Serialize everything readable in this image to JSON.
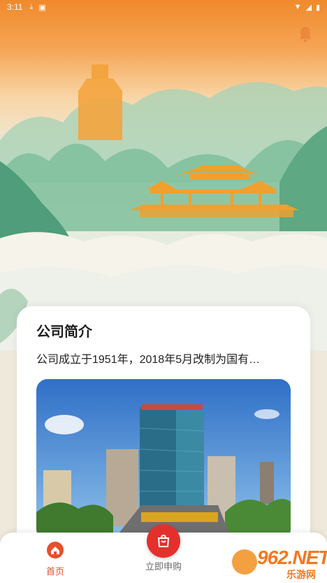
{
  "status_bar": {
    "time": "3:11",
    "icons": [
      "download-icon",
      "app-notification-icon"
    ],
    "right_icons": [
      "wifi-icon",
      "signal-icon",
      "battery-icon"
    ]
  },
  "header": {
    "bell_icon": "bell-icon"
  },
  "intro_card": {
    "title": "公司简介",
    "description": "公司成立于1951年，2018年5月改制为国有…"
  },
  "tabbar": {
    "home_label": "首页",
    "buy_label": "立即申购"
  },
  "watermark": {
    "main": "962.NET",
    "sub": "乐游网"
  },
  "colors": {
    "accent": "#e8502a",
    "buy_button": "#e4302d",
    "hero_top": "#f08a2c"
  }
}
